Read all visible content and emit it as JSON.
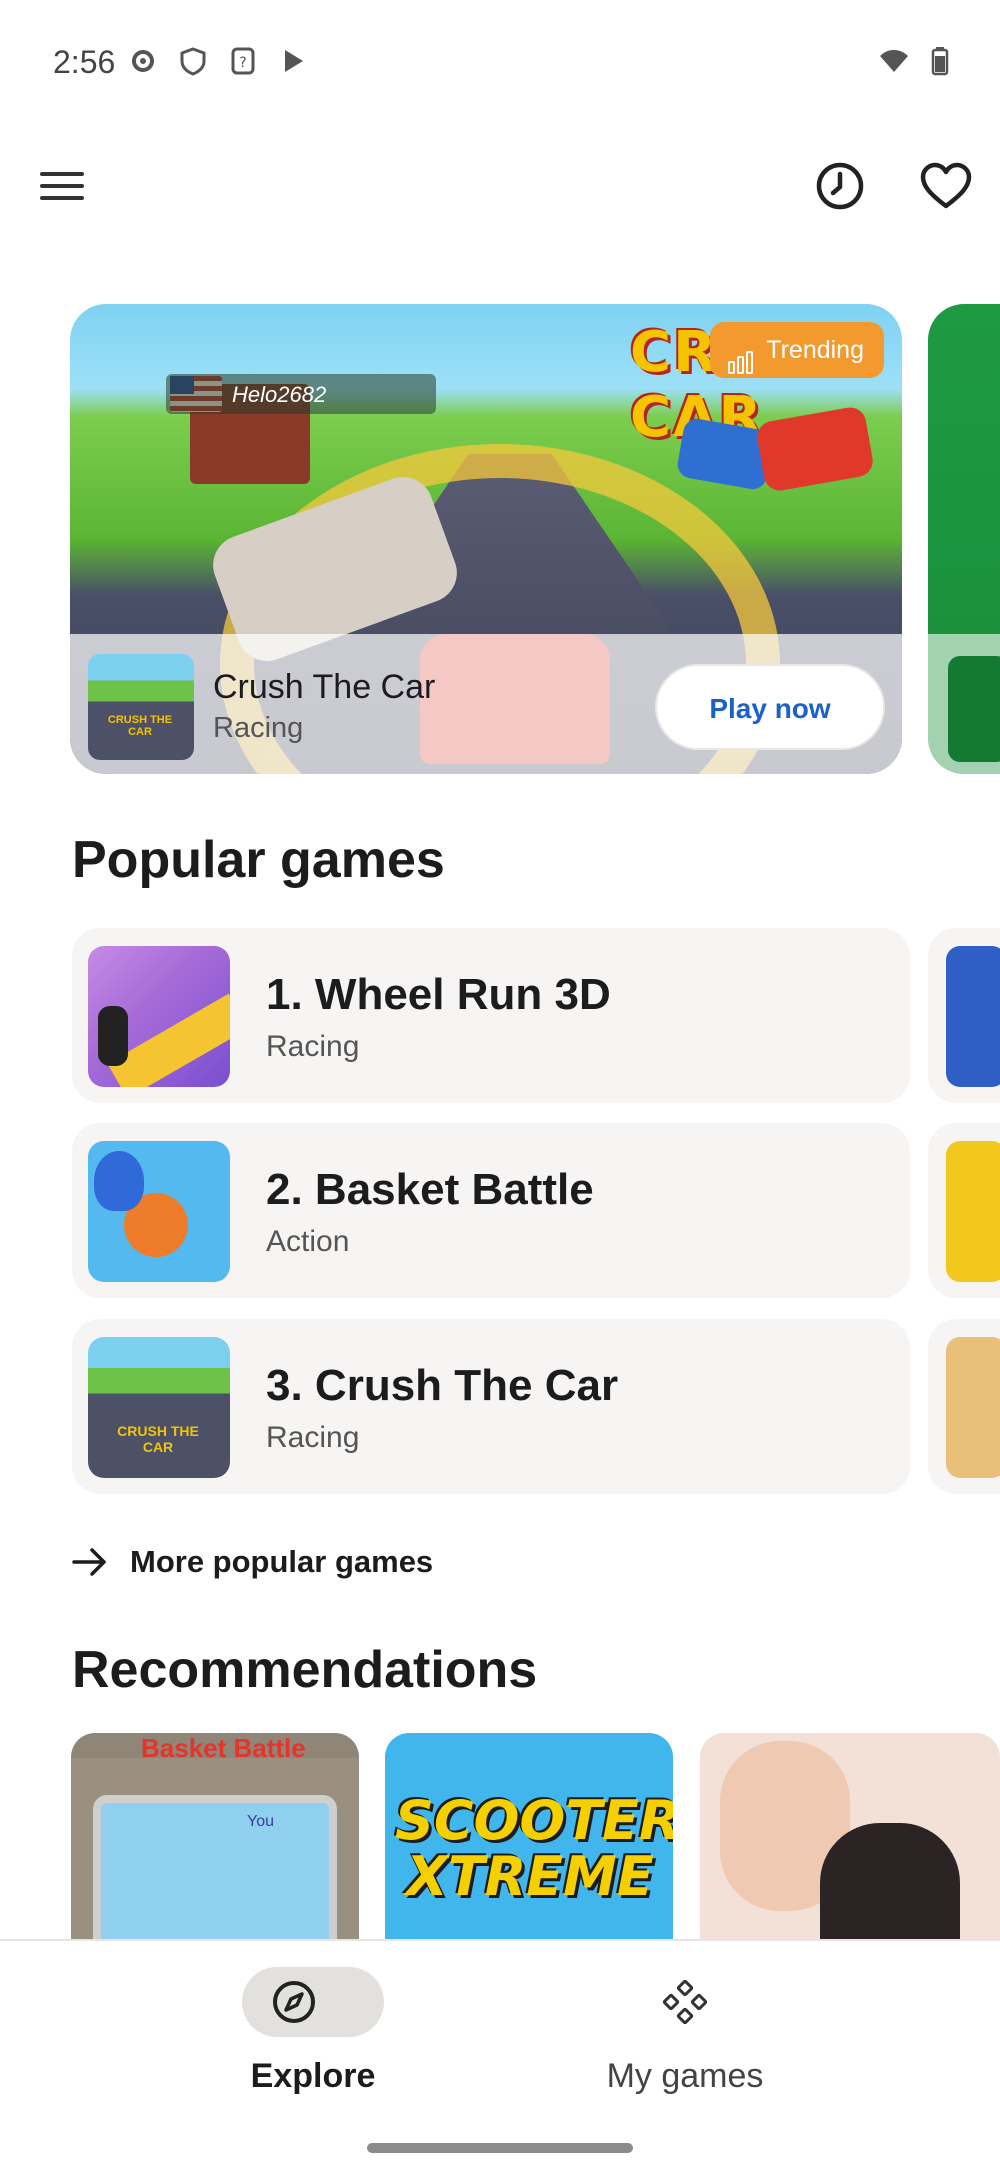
{
  "status_bar": {
    "time": "2:56",
    "icons_left": [
      "settings-icon",
      "shield-icon",
      "question-icon",
      "play-store-icon"
    ],
    "icons_right": [
      "wifi-icon",
      "battery-icon"
    ]
  },
  "top_bar": {
    "icons": [
      "menu-icon",
      "history-icon",
      "heart-icon"
    ]
  },
  "hero": {
    "badge_label": "Trending",
    "badge_color": "#f39a2f",
    "username": "Helo2682",
    "logo_text": "CRUSH CAR",
    "game_title": "Crush The Car",
    "game_genre": "Racing",
    "play_label": "Play now",
    "play_label_color": "#1a62c9"
  },
  "popular": {
    "title": "Popular games",
    "items": [
      {
        "name": "1. Wheel Run 3D",
        "genre": "Racing"
      },
      {
        "name": "2. Basket Battle",
        "genre": "Action"
      },
      {
        "name": "3. Crush The Car",
        "genre": "Racing"
      }
    ],
    "more_label": "More popular games"
  },
  "recommendations": {
    "title": "Recommendations",
    "cards": [
      {
        "art_text": "Basket Battle",
        "sub_text": "You"
      },
      {
        "art_text": "SCOOTER XTREME"
      },
      {
        "art_text": ""
      }
    ]
  },
  "bottom_nav": {
    "explore_label": "Explore",
    "my_games_label": "My games"
  }
}
